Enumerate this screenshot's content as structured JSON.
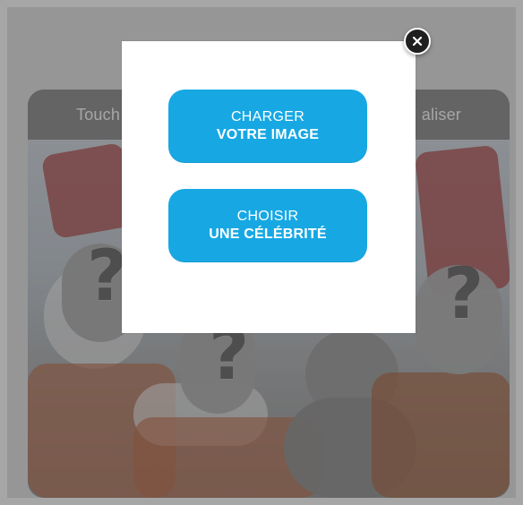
{
  "page": {
    "overlay_color": "#00000059",
    "accent_color": "#17a8e3"
  },
  "card": {
    "header": {
      "left_text": "Touch",
      "right_text": "aliser"
    }
  },
  "modal": {
    "close_icon": "close-icon",
    "buttons": [
      {
        "line1": "CHARGER",
        "line2": "VOTRE IMAGE"
      },
      {
        "line1": "CHOISIR",
        "line2": "UNE CÉLÉBRITÉ"
      }
    ]
  }
}
